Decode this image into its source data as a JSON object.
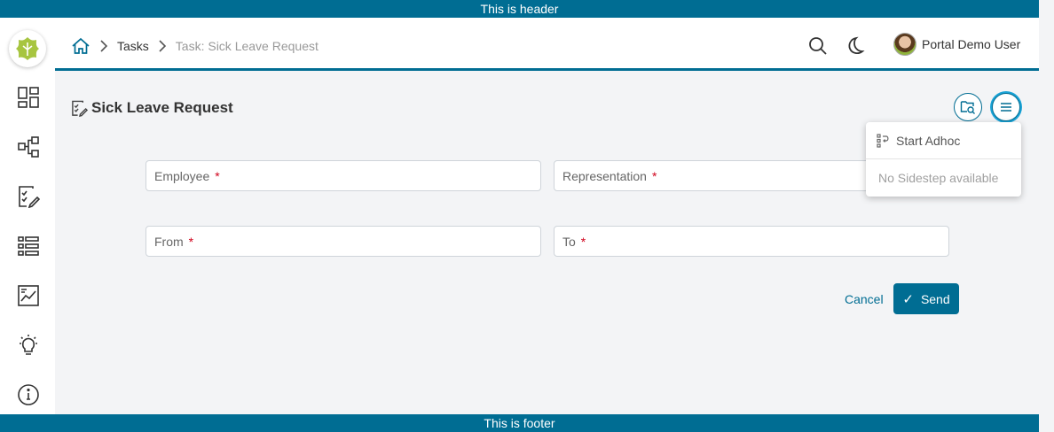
{
  "banners": {
    "header": "This is header",
    "footer": "This is footer"
  },
  "breadcrumb": {
    "tasks": "Tasks",
    "current": "Task: Sick Leave Request"
  },
  "user": {
    "name": "Portal Demo User"
  },
  "page": {
    "title": "Sick Leave Request"
  },
  "form": {
    "employee_label": "Employee",
    "representation_label": "Representation",
    "from_label": "From",
    "to_label": "To",
    "required_mark": "*"
  },
  "actions": {
    "cancel": "Cancel",
    "send": "Send",
    "send_icon": "✓"
  },
  "menu": {
    "start_adhoc": "Start Adhoc",
    "no_sidestep": "No Sidestep available"
  },
  "colors": {
    "primary": "#006d93",
    "required": "#d0021b",
    "accent": "#1aa3d6"
  }
}
